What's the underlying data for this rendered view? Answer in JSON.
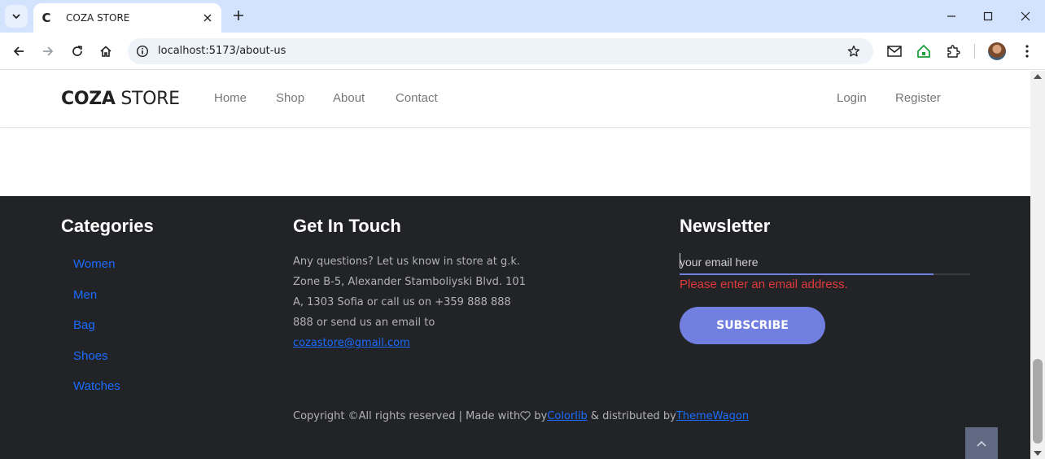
{
  "browser": {
    "tab_title": "COZA STORE",
    "tab_favicon": "C",
    "url": "localhost:5173/about-us"
  },
  "header": {
    "logo_bold": "COZA",
    "logo_rest": " STORE",
    "menu": [
      "Home",
      "Shop",
      "About",
      "Contact"
    ],
    "login": "Login",
    "register": "Register"
  },
  "footer": {
    "categories_title": "Categories",
    "categories": [
      "Women",
      "Men",
      "Bag",
      "Shoes",
      "Watches"
    ],
    "contact_title": "Get In Touch",
    "contact_lines": [
      "Any questions? Let us know in store at g.k.",
      "Zone B-5, Alexander Stamboliyski Blvd. 101",
      "A, 1303 Sofia or call us on +359 888 888",
      "888 or send us an email to"
    ],
    "contact_email": "cozastore@gmail.com",
    "newsletter_title": "Newsletter",
    "email_placeholder": "your email here",
    "email_error": "Please enter an email address.",
    "subscribe_label": "SUBSCRIBE",
    "copyright_prefix": "Copyright ©All rights reserved | Made with",
    "copyright_by": " by",
    "colorlib": "Colorlib",
    "distributed": " & distributed by",
    "themewagon": "ThemeWagon"
  },
  "colors": {
    "accent": "#717fe0",
    "footer_bg": "#222327",
    "link": "#1a6cff",
    "error": "#e03a3a"
  }
}
